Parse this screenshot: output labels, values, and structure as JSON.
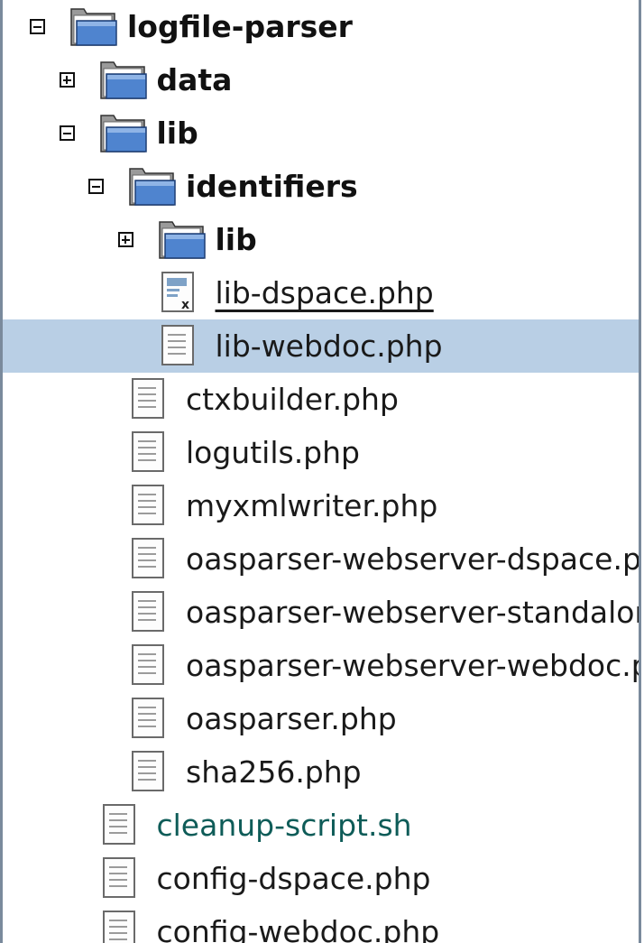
{
  "tree": {
    "rows": [
      {
        "label": "logfile-parser",
        "type": "folder",
        "expander": "minus",
        "level": 0
      },
      {
        "label": "data",
        "type": "folder",
        "expander": "plus",
        "level": 1
      },
      {
        "label": "lib",
        "type": "folder",
        "expander": "minus",
        "level": 1
      },
      {
        "label": "identifiers",
        "type": "folder",
        "expander": "minus",
        "level": 2
      },
      {
        "label": "lib",
        "type": "folder",
        "expander": "plus",
        "level": 3
      },
      {
        "label": "lib-dspace.php",
        "type": "file-special",
        "level": 3,
        "underlined": true
      },
      {
        "label": "lib-webdoc.php",
        "type": "file",
        "level": 3,
        "selected": true
      },
      {
        "label": "ctxbuilder.php",
        "type": "file",
        "level": 2
      },
      {
        "label": "logutils.php",
        "type": "file",
        "level": 2
      },
      {
        "label": "myxmlwriter.php",
        "type": "file",
        "level": 2
      },
      {
        "label": "oasparser-webserver-dspace.php",
        "type": "file",
        "level": 2
      },
      {
        "label": "oasparser-webserver-standalone.php",
        "type": "file",
        "level": 2
      },
      {
        "label": "oasparser-webserver-webdoc.php",
        "type": "file",
        "level": 2
      },
      {
        "label": "oasparser.php",
        "type": "file",
        "level": 2
      },
      {
        "label": "sha256.php",
        "type": "file",
        "level": 2
      },
      {
        "label": "cleanup-script.sh",
        "type": "file-script",
        "level": 1
      },
      {
        "label": "config-dspace.php",
        "type": "file",
        "level": 1
      },
      {
        "label": "config-webdoc.php",
        "type": "file",
        "level": 1
      }
    ]
  },
  "colors": {
    "selection": "#b9cfe5",
    "folder_blue": "#4f84cf",
    "script_text": "#0e5c58",
    "frame": "#7a8a9c"
  }
}
